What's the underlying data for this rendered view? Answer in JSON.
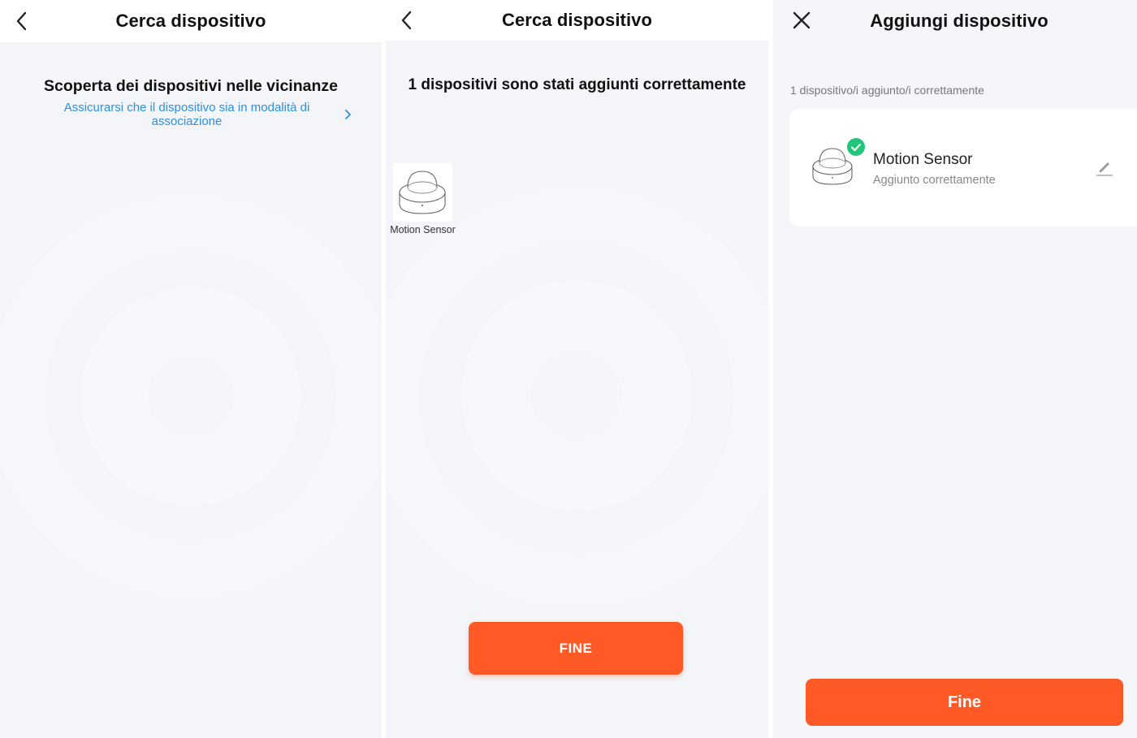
{
  "panels": [
    {
      "title": "Cerca dispositivo",
      "heading": "Scoperta dei dispositivi nelle vicinanze",
      "hint_link": "Assicurarsi che il dispositivo sia in modalità di associazione"
    },
    {
      "title": "Cerca dispositivo",
      "heading": "1 dispositivi sono stati aggiunti correttamente",
      "found_device": {
        "name": "Motion Sensor",
        "icon": "motion-sensor-icon"
      },
      "button": "FINE"
    },
    {
      "title": "Aggiungi dispositivo",
      "count_text": "1 dispositivo/i aggiunto/i correttamente",
      "device": {
        "name": "Motion Sensor",
        "status": "Aggiunto correttamente",
        "icon": "motion-sensor-icon"
      },
      "button": "Fine"
    }
  ],
  "colors": {
    "accent": "#ff5a26",
    "link": "#2b8fe6",
    "success": "#22c57a",
    "background": "#f3f5f9"
  }
}
